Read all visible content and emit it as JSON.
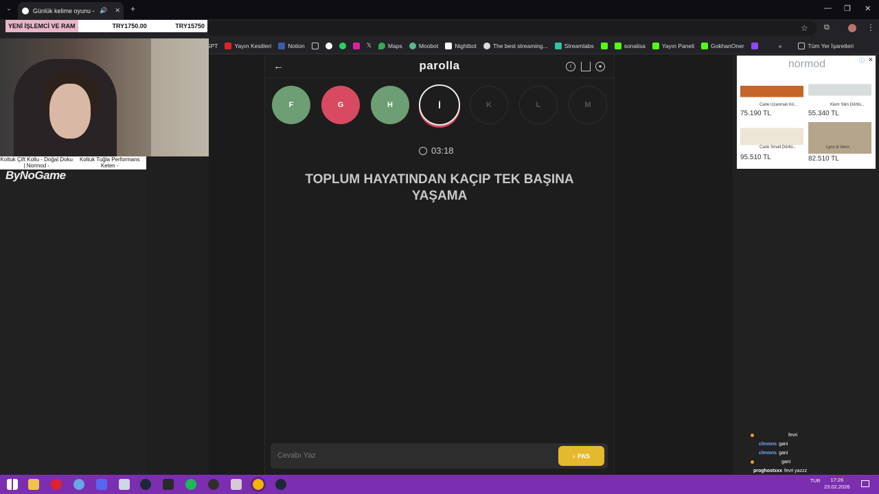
{
  "browser": {
    "tab_title": "Günlük kelime oyunu - parolla",
    "bookmarks": [
      "GPT",
      "Yayın Kesitleri",
      "Notion",
      "",
      "",
      "",
      "",
      "",
      "Maps",
      "Moobot",
      "Nightbot",
      "The best streaming...",
      "Streamlabs",
      "",
      "sonalisa",
      "Yayın Paneli",
      "GokhanOner",
      ""
    ],
    "all_bookmarks": "Tüm Yer İşaretleri"
  },
  "overlay": {
    "ticker_highlight": "YENİ İŞLEMCİ VE RAM",
    "ticker_price": "TRY1750.00",
    "ticker_price2": "TRY15750",
    "caption_left": "Koltuk Çift Kollu - Doğal Doku | Normod -",
    "caption_right": "Koltuk Tuğla Performans Keten -",
    "logo": "ByNoGame"
  },
  "game": {
    "title": "parolla",
    "letters": [
      {
        "char": "F",
        "state": "correct"
      },
      {
        "char": "G",
        "state": "wrong"
      },
      {
        "char": "H",
        "state": "correct"
      },
      {
        "char": "İ",
        "state": "current"
      },
      {
        "char": "K",
        "state": "pending"
      },
      {
        "char": "L",
        "state": "pending"
      },
      {
        "char": "M",
        "state": "pending"
      }
    ],
    "timer": "03:18",
    "clue": "TOPLUM HAYATINDAN KAÇIP TEK BAŞINA YAŞAMA",
    "input_placeholder": "Cevabı Yaz",
    "pass_label": "PAS"
  },
  "ad": {
    "brand": "normod",
    "items": [
      {
        "name": "Carle Uzanmalı Kö...",
        "price": "75.190 TL"
      },
      {
        "name": "Klem Slim Dörtlü...",
        "price": "55.340 TL"
      },
      {
        "name": "Carle Small Dörtlü...",
        "price": "95.510 TL"
      },
      {
        "name": "Lyno & Venn",
        "price": "82.510 TL"
      }
    ]
  },
  "chat": [
    {
      "user": "",
      "msg": "fevri"
    },
    {
      "user": "clevons",
      "msg": "gani"
    },
    {
      "user": "clevons",
      "msg": "gani"
    },
    {
      "user": "",
      "msg": "gani"
    },
    {
      "user": "proghostxxx",
      "msg": "fevri yazzz"
    }
  ],
  "system": {
    "lang": "TUR",
    "time": "17:26",
    "date": "23.02.2026"
  }
}
